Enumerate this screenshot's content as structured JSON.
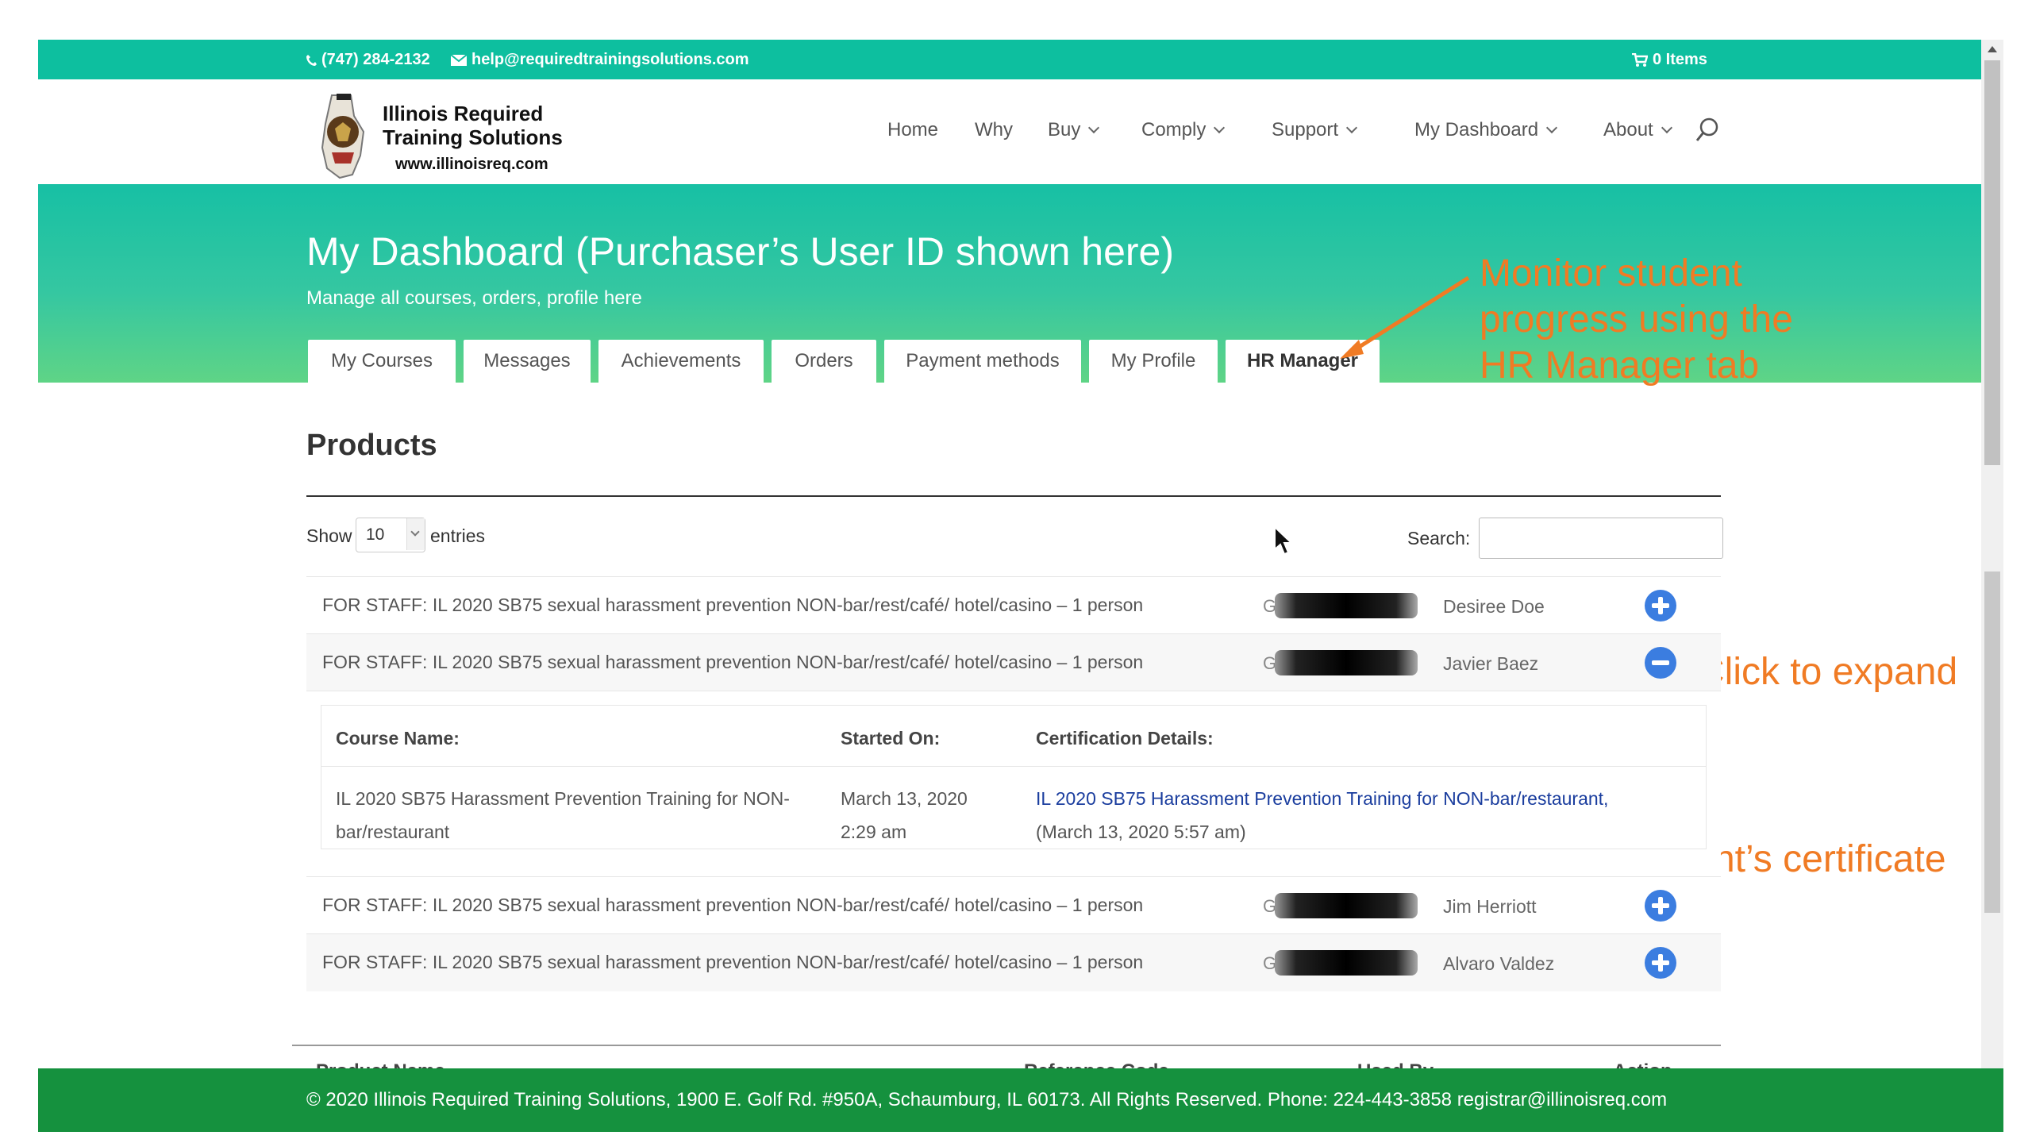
{
  "topbar": {
    "phone": "(747) 284-2132",
    "email": "help@requiredtrainingsolutions.com",
    "cart": "0 Items",
    "color": "#0dbf9f"
  },
  "logo": {
    "line1": "Illinois Required",
    "line2": "Training Solutions",
    "url": "www.illinoisreq.com"
  },
  "nav": {
    "items": [
      {
        "label": "Home"
      },
      {
        "label": "Why"
      },
      {
        "label": "Buy"
      },
      {
        "label": "Comply"
      },
      {
        "label": "Support"
      },
      {
        "label": "My Dashboard"
      },
      {
        "label": "About"
      }
    ],
    "search_icon": "search-icon"
  },
  "hero": {
    "title": "My Dashboard (Purchaser’s User ID shown here)",
    "subtitle": "Manage all courses, orders, profile here",
    "tabs": [
      {
        "label": "My Courses"
      },
      {
        "label": "Messages"
      },
      {
        "label": "Achievements"
      },
      {
        "label": "Orders"
      },
      {
        "label": "Payment methods"
      },
      {
        "label": "My Profile"
      },
      {
        "label": "HR Manager",
        "active": true
      }
    ]
  },
  "annotations": {
    "monitor": [
      "Monitor student",
      "progress using the",
      "HR Manager tab"
    ],
    "expand": "Click to expand",
    "download": "Click to download student’s certificate",
    "color": "#f07b24"
  },
  "products": {
    "title": "Products",
    "show_label": "Show",
    "entries_value": "10",
    "entries_label": "entries",
    "search_label": "Search:",
    "search_value": "",
    "rows": [
      {
        "product": "FOR STAFF: IL 2020 SB75 sexual harassment prevention NON-bar/rest/café/ hotel/casino – 1 person",
        "ref": "G-",
        "user": "Desiree Doe",
        "action": "expand"
      },
      {
        "product": "FOR STAFF: IL 2020 SB75 sexual harassment prevention NON-bar/rest/café/ hotel/casino – 1 person",
        "ref": "G-",
        "user": "Javier Baez",
        "action": "collapse"
      },
      {
        "product": "FOR STAFF: IL 2020 SB75 sexual harassment prevention NON-bar/rest/café/ hotel/casino – 1 person",
        "ref": "G",
        "user": "Jim Herriott",
        "action": "expand"
      },
      {
        "product": "FOR STAFF: IL 2020 SB75 sexual harassment prevention NON-bar/rest/café/ hotel/casino – 1 person",
        "ref": "G-",
        "user": "Alvaro Valdez",
        "action": "expand"
      }
    ],
    "detail": {
      "headers": [
        "Course Name:",
        "Started On:",
        "Certification Details:"
      ],
      "course_name_1": "IL 2020 SB75 Harassment Prevention Training for NON-",
      "course_name_2": "bar/restaurant",
      "started_1": "March 13, 2020",
      "started_2": "2:29 am",
      "cert_link": "IL 2020 SB75 Harassment Prevention Training for NON-bar/restaurant,",
      "cert_date": "(March 13, 2020 5:57 am)"
    },
    "columns": [
      "Product Name",
      "Reference Code",
      "Used By",
      "Action"
    ]
  },
  "footer": {
    "text": "© 2020 Illinois Required Training Solutions, 1900 E. Golf Rd. #950A, Schaumburg, IL 60173. All Rights Reserved. Phone: 224-443-3858 registrar@illinoisreq.com",
    "color": "#15913e"
  }
}
